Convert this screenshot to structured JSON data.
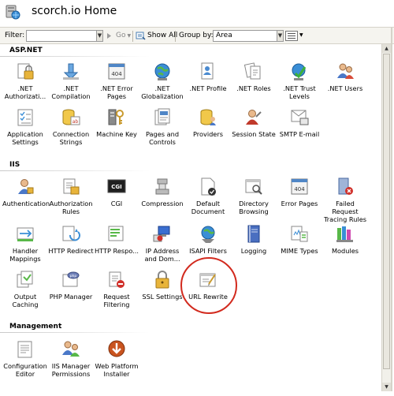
{
  "header": {
    "title": "scorch.io Home",
    "icon": "server-home-icon"
  },
  "toolbar": {
    "filter_label": "Filter:",
    "go_label": "Go",
    "show_all_label": "Show All",
    "group_by_label": "Group by:",
    "group_by_value": "Area"
  },
  "groups": {
    "aspnet": "ASP.NET",
    "iis": "IIS",
    "management": "Management"
  },
  "aspnet_items": [
    {
      "label": ".NET Authorizati...",
      "icon": "lock-icon"
    },
    {
      "label": ".NET Compilation",
      "icon": "download-arrow-icon"
    },
    {
      "label": ".NET Error Pages",
      "icon": "error-page-icon"
    },
    {
      "label": ".NET Globalization",
      "icon": "globe-icon"
    },
    {
      "label": ".NET Profile",
      "icon": "profile-icon"
    },
    {
      "label": ".NET Roles",
      "icon": "roles-icon"
    },
    {
      "label": ".NET Trust Levels",
      "icon": "trust-check-icon"
    },
    {
      "label": ".NET Users",
      "icon": "users-icon"
    },
    {
      "label": "Application Settings",
      "icon": "settings-list-icon"
    },
    {
      "label": "Connection Strings",
      "icon": "database-icon"
    },
    {
      "label": "Machine Key",
      "icon": "key-icon"
    },
    {
      "label": "Pages and Controls",
      "icon": "pages-icon"
    },
    {
      "label": "Providers",
      "icon": "providers-icon"
    },
    {
      "label": "Session State",
      "icon": "session-user-icon"
    },
    {
      "label": "SMTP E-mail",
      "icon": "email-icon"
    }
  ],
  "iis_items": [
    {
      "label": "Authentication",
      "icon": "authentication-user-icon"
    },
    {
      "label": "Authorization Rules",
      "icon": "authorization-icon"
    },
    {
      "label": "CGI",
      "icon": "cgi-icon"
    },
    {
      "label": "Compression",
      "icon": "compression-icon"
    },
    {
      "label": "Default Document",
      "icon": "default-document-icon"
    },
    {
      "label": "Directory Browsing",
      "icon": "directory-browsing-icon"
    },
    {
      "label": "Error Pages",
      "icon": "error-pages-icon"
    },
    {
      "label": "Failed Request Tracing Rules",
      "icon": "failed-request-icon"
    },
    {
      "label": "Handler Mappings",
      "icon": "handler-mappings-icon"
    },
    {
      "label": "HTTP Redirect",
      "icon": "http-redirect-icon"
    },
    {
      "label": "HTTP Respo...",
      "icon": "http-response-icon"
    },
    {
      "label": "IP Address and Dom...",
      "icon": "ip-address-icon"
    },
    {
      "label": "ISAPI Filters",
      "icon": "isapi-filters-icon"
    },
    {
      "label": "Logging",
      "icon": "logging-book-icon"
    },
    {
      "label": "MIME Types",
      "icon": "mime-types-icon"
    },
    {
      "label": "Modules",
      "icon": "modules-icon"
    },
    {
      "label": "Output Caching",
      "icon": "output-caching-icon"
    },
    {
      "label": "PHP Manager",
      "icon": "php-icon"
    },
    {
      "label": "Request Filtering",
      "icon": "request-filtering-icon"
    },
    {
      "label": "SSL Settings",
      "icon": "ssl-lock-icon"
    },
    {
      "label": "URL Rewrite",
      "icon": "url-rewrite-icon"
    }
  ],
  "management_items": [
    {
      "label": "Configuration Editor",
      "icon": "configuration-editor-icon"
    },
    {
      "label": "IIS Manager Permissions",
      "icon": "permissions-icon"
    },
    {
      "label": "Web Platform Installer",
      "icon": "web-platform-installer-icon"
    }
  ],
  "colors": {
    "highlight_ring": "#d22a1e",
    "toolbar_bg": "#f5f4ef"
  }
}
